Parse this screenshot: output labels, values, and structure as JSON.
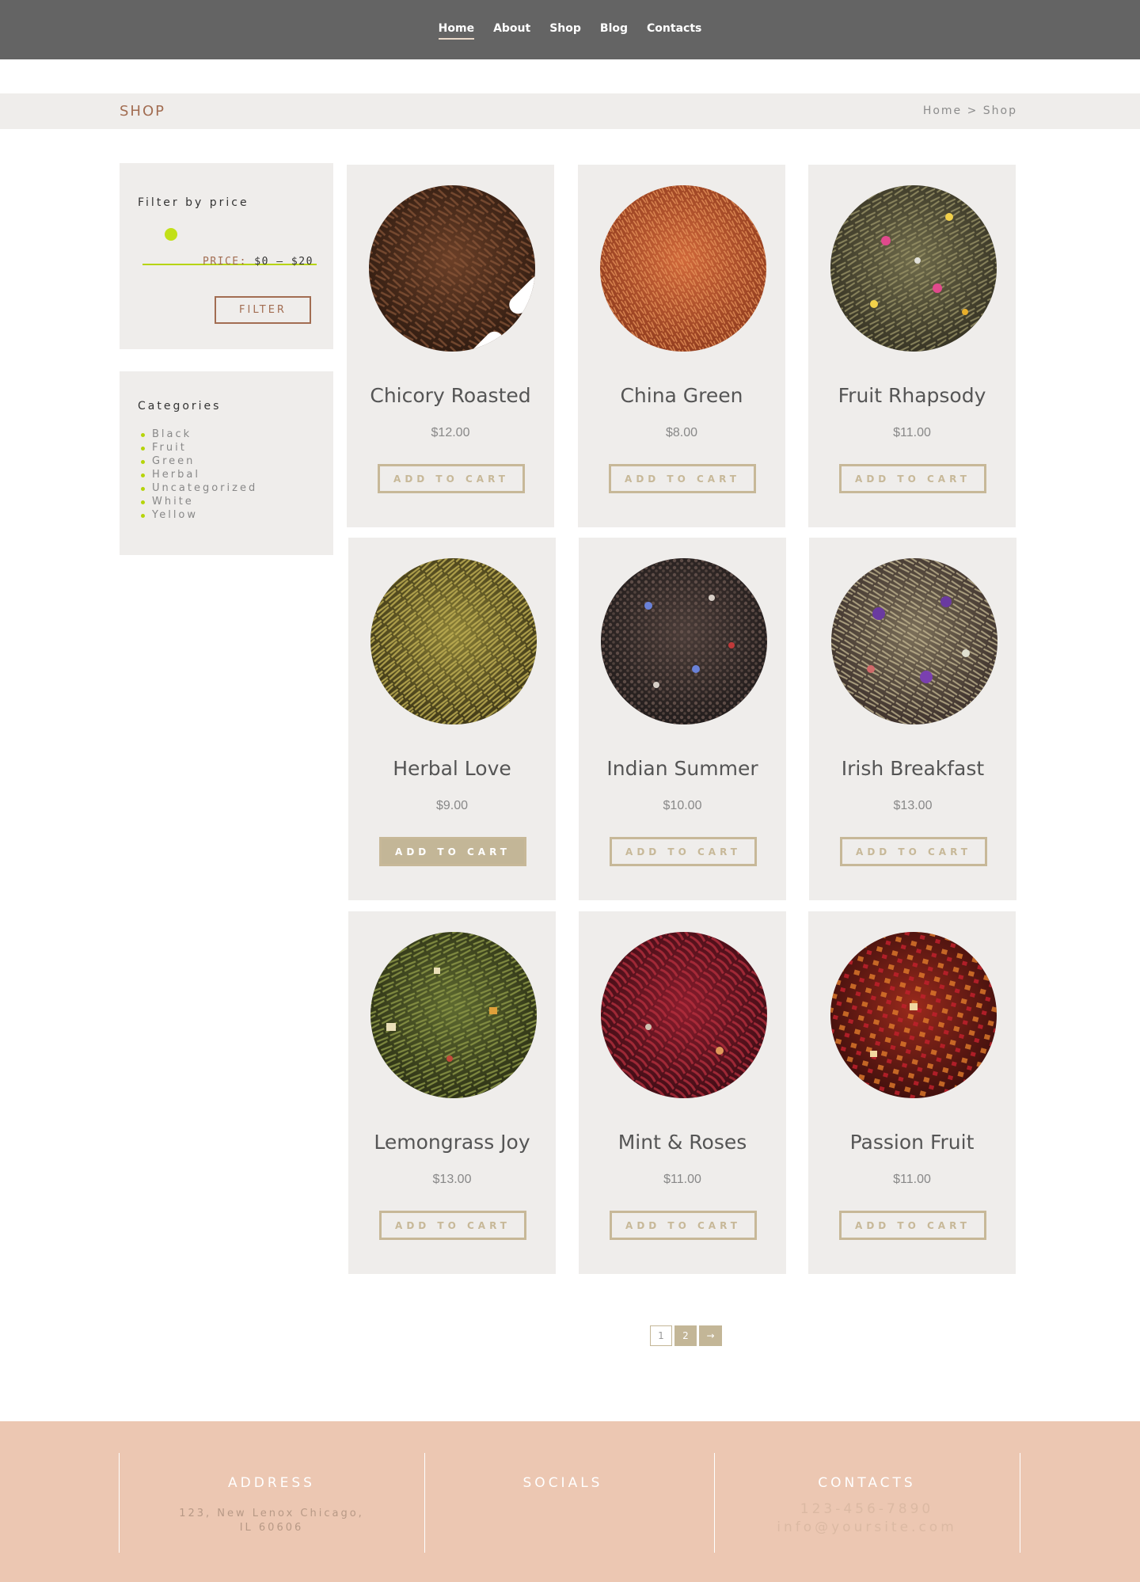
{
  "nav": {
    "items": [
      "Home",
      "About",
      "Shop",
      "Blog",
      "Contacts"
    ]
  },
  "shopbar": {
    "title": "SHOP",
    "breadcrumb": "Home > Shop"
  },
  "filter": {
    "title": "Filter by price",
    "price_label": "PRICE:",
    "price_range": "$0 — $20",
    "button": "FILTER",
    "accent": "#b6d40a"
  },
  "categories": {
    "title": "Categories",
    "items": [
      "Black",
      "Fruit",
      "Green",
      "Herbal",
      "Uncategorized",
      "White",
      "Yellow"
    ]
  },
  "products": [
    {
      "name": "Chicory Roasted",
      "price": "$12.00",
      "button": "ADD TO CART"
    },
    {
      "name": "China Green",
      "price": "$8.00",
      "button": "ADD TO CART"
    },
    {
      "name": "Fruit Rhapsody",
      "price": "$11.00",
      "button": "ADD TO CART"
    },
    {
      "name": "Herbal Love",
      "price": "$9.00",
      "button": "ADD TO CART"
    },
    {
      "name": "Indian Summer",
      "price": "$10.00",
      "button": "ADD TO CART"
    },
    {
      "name": "Irish Breakfast",
      "price": "$13.00",
      "button": "ADD TO CART"
    },
    {
      "name": "Lemongrass Joy",
      "price": "$13.00",
      "button": "ADD TO CART"
    },
    {
      "name": "Mint & Roses",
      "price": "$11.00",
      "button": "ADD TO CART"
    },
    {
      "name": "Passion Fruit",
      "price": "$11.00",
      "button": "ADD TO CART"
    }
  ],
  "pagination": {
    "page1": "1",
    "page2": "2",
    "next": "→"
  },
  "footer": {
    "address_title": "ADDRESS",
    "address_line1": "123, New Lenox Chicago,",
    "address_line2": "IL 60606",
    "socials_title": "SOCIALS",
    "contacts_title": "CONTACTS",
    "phone": "123-456-7890",
    "email": "info@yoursite.com"
  },
  "colors": {
    "nav_bg": "#646464",
    "brand_brown": "#a26d52",
    "button_tan": "#c3b697",
    "footer_bg": "#ecc7b2"
  }
}
